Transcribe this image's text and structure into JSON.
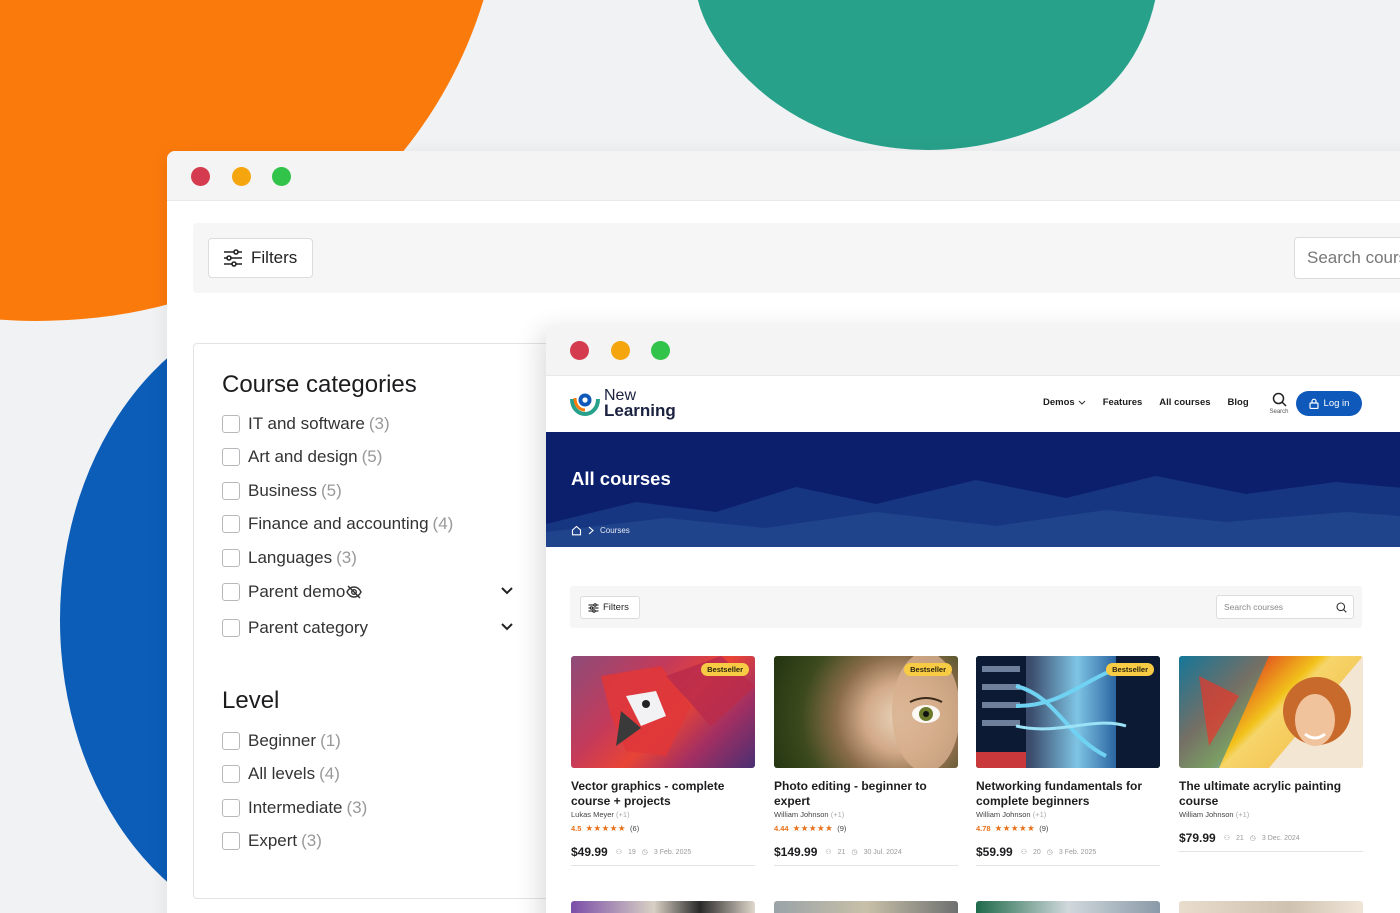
{
  "back_window": {
    "filters_label": "Filters",
    "search_placeholder": "Search courses",
    "categories_heading": "Course categories",
    "categories": [
      {
        "label": "IT and software",
        "count": "(3)"
      },
      {
        "label": "Art and design",
        "count": "(5)"
      },
      {
        "label": "Business",
        "count": "(5)"
      },
      {
        "label": "Finance and accounting",
        "count": "(4)"
      },
      {
        "label": "Languages",
        "count": "(3)"
      },
      {
        "label": "Parent demo",
        "count": ""
      },
      {
        "label": "Parent category",
        "count": ""
      }
    ],
    "level_heading": "Level",
    "levels": [
      {
        "label": "Beginner",
        "count": "(1)"
      },
      {
        "label": "All levels",
        "count": "(4)"
      },
      {
        "label": "Intermediate",
        "count": "(3)"
      },
      {
        "label": "Expert",
        "count": "(3)"
      }
    ]
  },
  "front_window": {
    "logo": {
      "line1": "New",
      "line2": "Learning"
    },
    "nav": {
      "demos": "Demos",
      "features": "Features",
      "all_courses": "All courses",
      "blog": "Blog",
      "search": "Search",
      "login": "Log in"
    },
    "hero": {
      "title": "All courses",
      "crumb": "Courses"
    },
    "filters_label": "Filters",
    "search_placeholder": "Search courses",
    "courses": [
      {
        "badge": "Bestseller",
        "title": "Vector graphics - complete course + projects",
        "author": "Lukas Meyer",
        "extra": "(+1)",
        "rating": "4.5",
        "stars": "★★★★★",
        "reviews": "(6)",
        "price": "$49.99",
        "students": "19",
        "date": "3 Feb. 2025"
      },
      {
        "badge": "Bestseller",
        "title": "Photo editing - beginner to expert",
        "author": "William Johnson",
        "extra": "(+1)",
        "rating": "4.44",
        "stars": "★★★★★",
        "reviews": "(9)",
        "price": "$149.99",
        "students": "21",
        "date": "30 Jul. 2024"
      },
      {
        "badge": "Bestseller",
        "title": "Networking fundamentals for complete beginners",
        "author": "William Johnson",
        "extra": "(+1)",
        "rating": "4.78",
        "stars": "★★★★★",
        "reviews": "(9)",
        "price": "$59.99",
        "students": "20",
        "date": "3 Feb. 2025"
      },
      {
        "badge": "",
        "title": "The ultimate acrylic painting course",
        "author": "William Johnson",
        "extra": "(+1)",
        "rating": "",
        "stars": "",
        "reviews": "",
        "price": "$79.99",
        "students": "21",
        "date": "3 Dec. 2024"
      }
    ]
  },
  "colors": {
    "orange": "#fb7a0c",
    "teal": "#28a18a",
    "blue": "#0b5db8",
    "navy": "#0c1f6d",
    "accent": "#0f59ba",
    "star": "#e8701a",
    "badge": "#f7cb44"
  }
}
